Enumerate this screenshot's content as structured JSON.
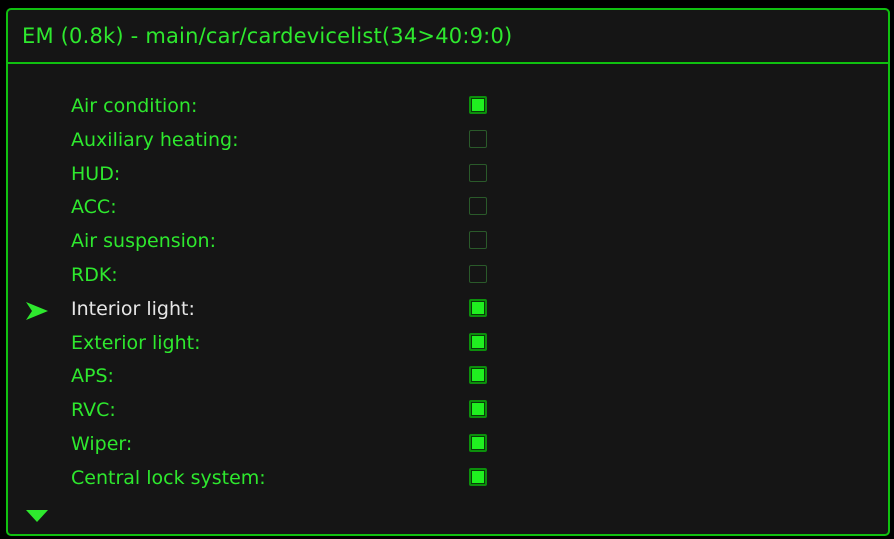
{
  "header": {
    "title": "EM (0.8k) - main/car/cardevicelist(34>40:9:0)"
  },
  "colors": {
    "accent": "#2ee82e",
    "border": "#10c010",
    "selected_text": "#e6e6e6",
    "background": "#151515"
  },
  "icons": {
    "cursor": "arrow-right-icon",
    "scroll": "triangle-down-icon"
  },
  "selected_index": 6,
  "items": [
    {
      "label": "Air condition:",
      "checked": true
    },
    {
      "label": "Auxiliary heating:",
      "checked": false
    },
    {
      "label": "HUD:",
      "checked": false
    },
    {
      "label": "ACC:",
      "checked": false
    },
    {
      "label": "Air suspension:",
      "checked": false
    },
    {
      "label": "RDK:",
      "checked": false
    },
    {
      "label": "Interior light:",
      "checked": true
    },
    {
      "label": "Exterior light:",
      "checked": true
    },
    {
      "label": "APS:",
      "checked": true
    },
    {
      "label": "RVC:",
      "checked": true
    },
    {
      "label": "Wiper:",
      "checked": true
    },
    {
      "label": "Central lock system:",
      "checked": true
    }
  ]
}
